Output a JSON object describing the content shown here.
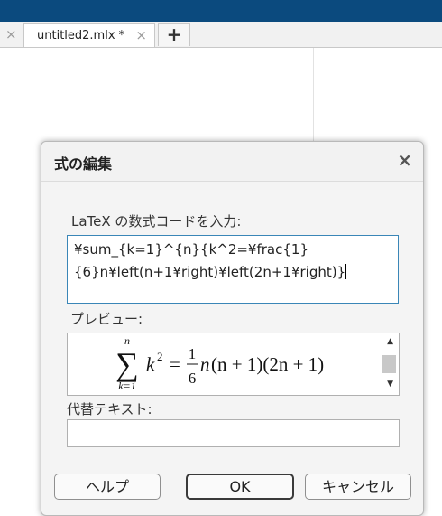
{
  "tabs": {
    "active_label": "untitled2.mlx *",
    "close_icon": "×",
    "add_icon": "+"
  },
  "dialog": {
    "title": "式の編集",
    "close_icon": "×",
    "latex_label": "LaTeX の数式コードを入力:",
    "latex_line1": "¥sum_{k=1}^{n}{k^2=¥frac{1}",
    "latex_line2": "{6}n¥left(n+1¥right)¥left(2n+1¥right)}",
    "preview_label": "プレビュー:",
    "preview": {
      "sum_top": "n",
      "sum_symbol": "∑",
      "sum_bottom": "k=1",
      "k": "k",
      "exp": "2",
      "eq": "=",
      "frac_num": "1",
      "frac_den": "6",
      "n": "n",
      "rest": "(n + 1)(2n + 1)"
    },
    "alt_text_label": "代替テキスト:",
    "alt_text_value": "",
    "buttons": {
      "help": "ヘルプ",
      "ok": "OK",
      "cancel": "キャンセル"
    }
  },
  "colors": {
    "titlebar": "#0b4a7e",
    "focus_border": "#3a86b7"
  }
}
